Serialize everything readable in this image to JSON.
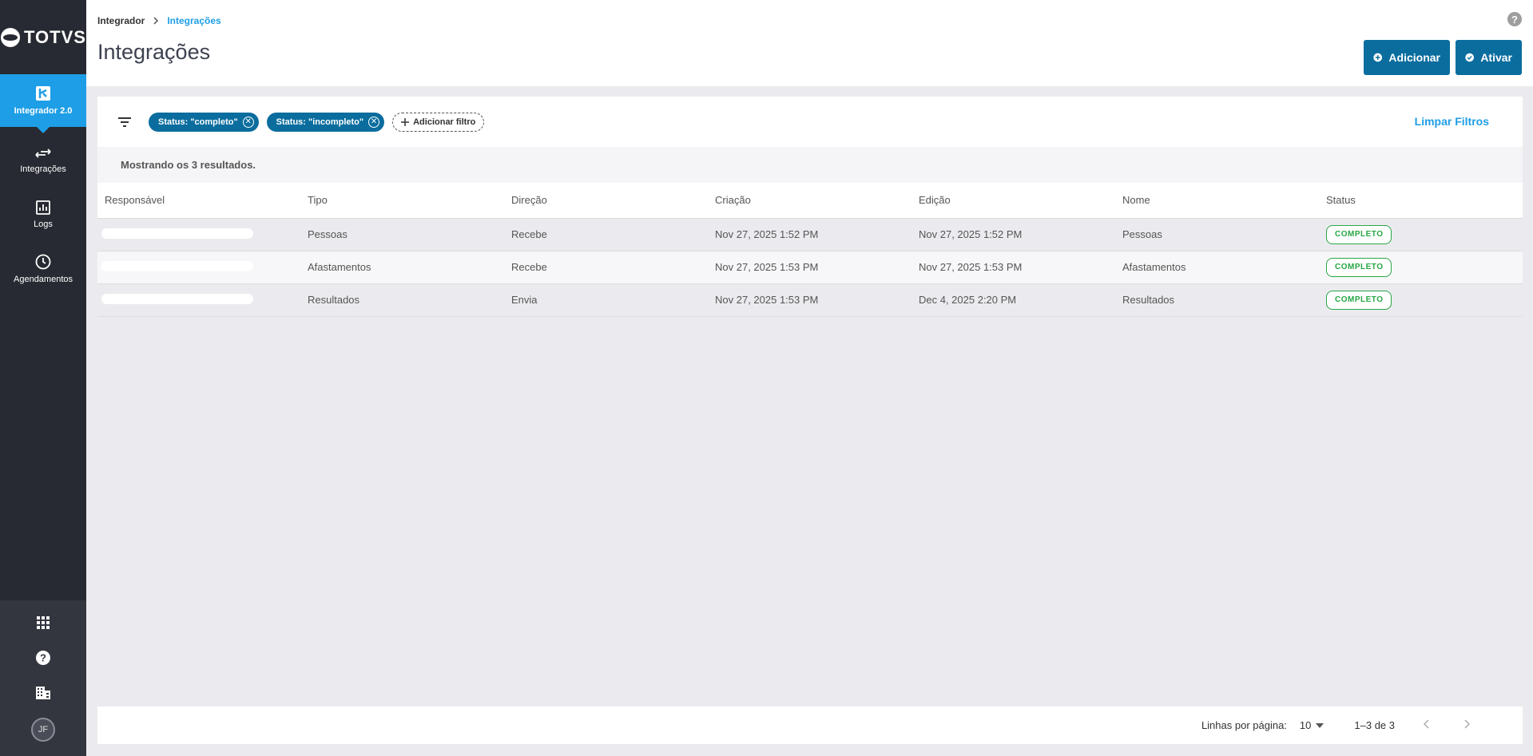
{
  "brand": {
    "name": "TOTVS",
    "accent": "#1e9ee6",
    "primary": "#0a6d9e",
    "success": "#28a745"
  },
  "sidebar": {
    "items": [
      {
        "label": "Integrador 2.0",
        "icon": "integrator-icon",
        "active": true
      },
      {
        "label": "Integrações",
        "icon": "arrows-swap-icon",
        "active": false
      },
      {
        "label": "Logs",
        "icon": "chart-icon",
        "active": false
      },
      {
        "label": "Agendamentos",
        "icon": "clock-icon",
        "active": false
      }
    ],
    "bottom": [
      "apps-grid-icon",
      "help-icon",
      "building-icon"
    ],
    "avatar_initials": "JF"
  },
  "header": {
    "breadcrumb": {
      "parent": "Integrador",
      "current": "Integrações"
    },
    "title": "Integrações",
    "add_label": "Adicionar",
    "activate_label": "Ativar"
  },
  "filters": {
    "chips": [
      "Status: \"completo\"",
      "Status: \"incompleto\""
    ],
    "add_filter_label": "Adicionar filtro",
    "clear_label": "Limpar Filtros"
  },
  "results_text": "Mostrando os 3 resultados.",
  "table": {
    "columns": [
      "Responsável",
      "Tipo",
      "Direção",
      "Criação",
      "Edição",
      "Nome",
      "Status"
    ],
    "rows": [
      {
        "tipo": "Pessoas",
        "direcao": "Recebe",
        "criacao": "Nov 27, 2025 1:52 PM",
        "edicao": "Nov 27, 2025 1:52 PM",
        "nome": "Pessoas",
        "status": "COMPLETO"
      },
      {
        "tipo": "Afastamentos",
        "direcao": "Recebe",
        "criacao": "Nov 27, 2025 1:53 PM",
        "edicao": "Nov 27, 2025 1:53 PM",
        "nome": "Afastamentos",
        "status": "COMPLETO"
      },
      {
        "tipo": "Resultados",
        "direcao": "Envia",
        "criacao": "Nov 27, 2025 1:53 PM",
        "edicao": "Dec 4, 2025 2:20 PM",
        "nome": "Resultados",
        "status": "COMPLETO"
      }
    ]
  },
  "pagination": {
    "rows_per_page_label": "Linhas por página:",
    "rows_per_page": "10",
    "range": "1–3 de 3"
  }
}
